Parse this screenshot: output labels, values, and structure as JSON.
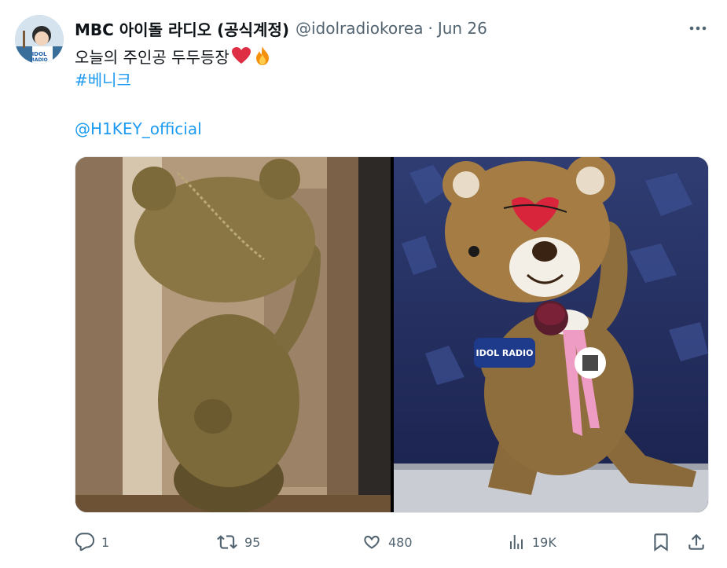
{
  "tweet": {
    "display_name": "MBC 아이돌 라디오 (공식계정)",
    "handle": "@idolradiokorea",
    "separator": "·",
    "date": "Jun 26",
    "text_line1": "오늘의 주인공 두두등장",
    "hashtag": "#베니크",
    "mention": "@H1KEY_official",
    "emojis": [
      "red-heart-emoji",
      "fire-emoji"
    ],
    "media": [
      {
        "icon": "bear-mascot-back-photo"
      },
      {
        "icon": "bear-mascot-front-photo",
        "badge_text": "IDOL RADIO"
      }
    ]
  },
  "actions": {
    "reply": {
      "icon": "reply-icon",
      "count": "1"
    },
    "retweet": {
      "icon": "retweet-icon",
      "count": "95"
    },
    "like": {
      "icon": "like-icon",
      "count": "480"
    },
    "views": {
      "icon": "views-icon",
      "count": "19K"
    },
    "bookmark": {
      "icon": "bookmark-icon"
    },
    "share": {
      "icon": "share-icon"
    }
  },
  "colors": {
    "text": "#0f1419",
    "secondary": "#536471",
    "link": "#1d9bf0",
    "heart": "#e0245e"
  }
}
